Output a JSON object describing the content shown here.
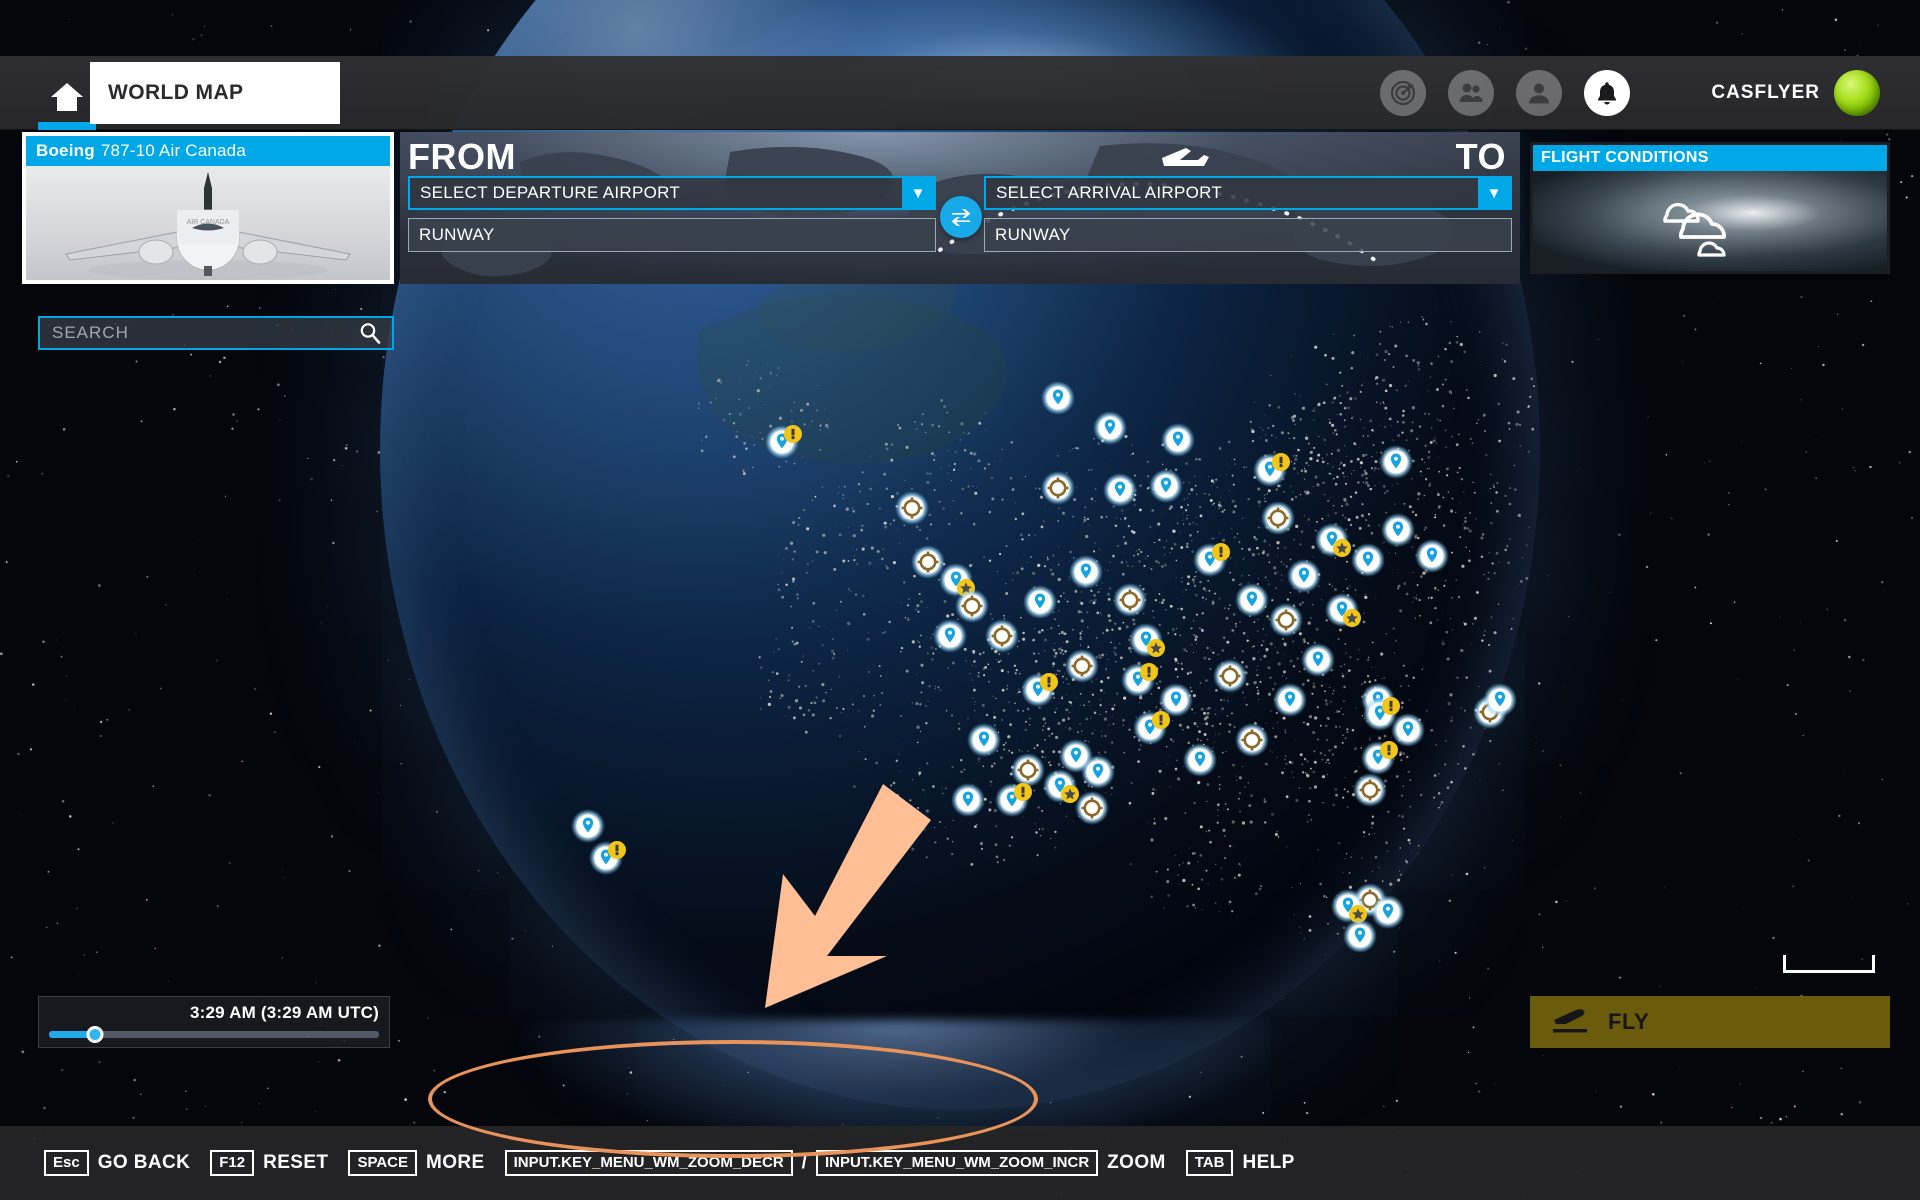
{
  "app": {
    "title": "WORLD MAP",
    "home_icon": "home-icon"
  },
  "header": {
    "tab_label": "WORLD MAP",
    "icons": [
      {
        "name": "radar-icon",
        "label": "Radar"
      },
      {
        "name": "friends-icon",
        "label": "Friends"
      },
      {
        "name": "profile-icon",
        "label": "Profile"
      },
      {
        "name": "notification-bell-icon",
        "label": "Notifications"
      }
    ],
    "user_name": "CASFLYER",
    "avatar": "green-orb-avatar"
  },
  "aircraft_card": {
    "manufacturer": "Boeing",
    "model": "787-10 Air Canada",
    "title_full": "Boeing 787-10 Air Canada"
  },
  "route": {
    "from_label": "FROM",
    "to_label": "TO",
    "departure_airport": "SELECT DEPARTURE AIRPORT",
    "arrival_airport": "SELECT ARRIVAL AIRPORT",
    "departure_runway": "RUNWAY",
    "arrival_runway": "RUNWAY",
    "swap_icon": "swap-arrows-icon",
    "dropdown_icon": "chevron-down-icon"
  },
  "flight_conditions": {
    "title": "FLIGHT CONDITIONS",
    "weather_icon": "clouds-icon"
  },
  "search": {
    "placeholder": "SEARCH",
    "value": "",
    "icon": "search-icon"
  },
  "time": {
    "label": "3:29 AM (3:29 AM UTC)",
    "local": "3:29 AM",
    "utc": "3:29 AM UTC",
    "slider_percent": 14
  },
  "fly": {
    "label": "FLY",
    "icon": "takeoff-plane-icon",
    "enabled": false
  },
  "scale_bar": {
    "label": ""
  },
  "hints": [
    {
      "key": "Esc",
      "label": "GO BACK"
    },
    {
      "key": "F12",
      "label": "RESET"
    },
    {
      "key": "SPACE",
      "label": "MORE"
    },
    {
      "key": "INPUT.KEY_MENU_WM_ZOOM_DECR",
      "separator": "/",
      "key2": "INPUT.KEY_MENU_WM_ZOOM_INCR",
      "label": "ZOOM"
    },
    {
      "key": "TAB",
      "label": "HELP"
    }
  ],
  "colors": {
    "accent_cyan": "#00a8e8",
    "panel_dark": "#23262c",
    "fly_olive": "#6b5b0c",
    "annotation_orange": "#e8935a",
    "annotation_arrow": "#ffbe94",
    "avatar_green": "#a8e01f"
  },
  "map": {
    "view": "North America night lights globe view",
    "marker_types": [
      "airport-pin-marker",
      "compass-marker",
      "exclamation-badge",
      "star-badge"
    ]
  }
}
